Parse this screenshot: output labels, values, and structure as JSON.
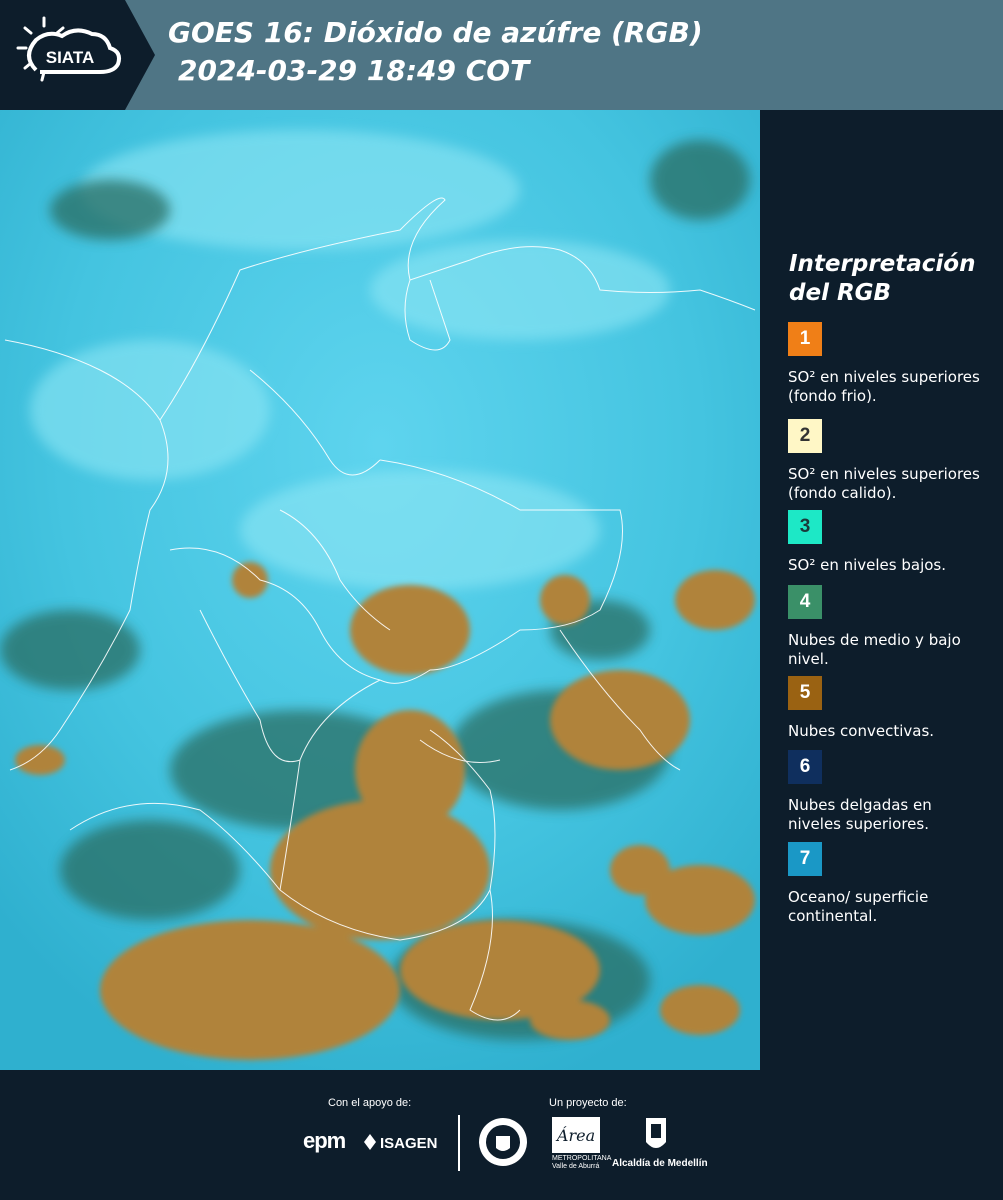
{
  "header": {
    "logo_text": "SIATA",
    "title_line1": "GOES 16: Dióxido de azúfre (RGB)",
    "title_line2": "2024-03-29 18:49 COT",
    "background_color": "#4f7585"
  },
  "legend": {
    "title_line1": "Interpretación",
    "title_line2": "del RGB",
    "items": [
      {
        "number": "1",
        "label": "SO² en niveles superiores (fondo frio).",
        "color": "#f07f17",
        "text_color": "#ffffff"
      },
      {
        "number": "2",
        "label": "SO² en niveles superiores (fondo calido).",
        "color": "#fff7c6",
        "text_color": "#333333"
      },
      {
        "number": "3",
        "label": "SO² en niveles bajos.",
        "color": "#1de8c6",
        "text_color": "#1a3a3a"
      },
      {
        "number": "4",
        "label": "Nubes de medio y bajo nivel.",
        "color": "#3a9068",
        "text_color": "#ffffff"
      },
      {
        "number": "5",
        "label": "Nubes convectivas.",
        "color": "#9a6212",
        "text_color": "#ffffff"
      },
      {
        "number": "6",
        "label": "Nubes delgadas en niveles superiores.",
        "color": "#0f2f5e",
        "text_color": "#ffffff"
      },
      {
        "number": "7",
        "label": "Oceano/ superficie continental.",
        "color": "#1a98c6",
        "text_color": "#ffffff"
      }
    ]
  },
  "footer": {
    "support_label": "Con el apoyo de:",
    "project_label": "Un proyecto de:",
    "epm": "epm",
    "isagen": "ISAGEN",
    "area_metropolitana": "METROPOLITANA Valle de Aburrá",
    "alcaldia": "Alcaldía de Medellín"
  },
  "map": {
    "ocean_color": "#4fcfe8",
    "convective_color": "#b0833a",
    "border_color": "#ffffff"
  }
}
